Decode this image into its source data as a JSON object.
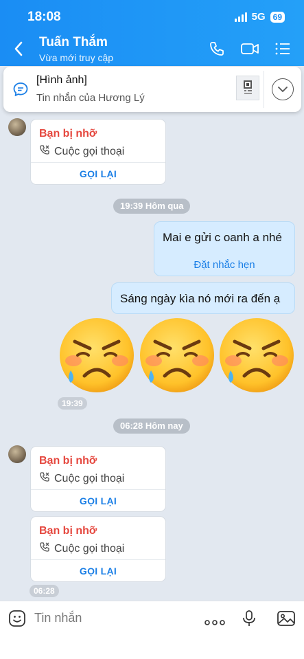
{
  "status_bar": {
    "time": "18:08",
    "network": "5G",
    "battery": "69"
  },
  "header": {
    "contact_name": "Tuấn Thắm",
    "status": "Vừa mới truy cập",
    "bg_color": "#1a8df4"
  },
  "pinned": {
    "title": "[Hình ảnh]",
    "subtitle": "Tin nhắn của Hương Lý"
  },
  "messages": {
    "call1": {
      "title": "Bạn bị nhỡ",
      "type": "Cuộc gọi thoại",
      "action": "GỌI LẠI"
    },
    "date1": "19:39 Hôm qua",
    "out1": {
      "text": "Mai e gửi c oanh a nhé",
      "action": "Đặt nhắc hẹn"
    },
    "out2": {
      "text": "Sáng ngày kìa nó mới ra đến ạ"
    },
    "emoji_time": "19:39",
    "date2": "06:28 Hôm nay",
    "call2": {
      "title": "Bạn bị nhỡ",
      "type": "Cuộc gọi thoại",
      "action": "GỌI LẠI"
    },
    "call3": {
      "title": "Bạn bị nhỡ",
      "type": "Cuộc gọi thoại",
      "action": "GỌI LẠI"
    },
    "call_time": "06:28"
  },
  "composer": {
    "placeholder": "Tin nhắn"
  },
  "colors": {
    "missed": "#e5483f",
    "link": "#1b7fe6",
    "outgoing": "#d6ecff"
  },
  "icons": [
    "back-icon",
    "phone-icon",
    "video-icon",
    "list-icon",
    "chat-bubble-icon",
    "chevron-down-icon",
    "missed-call-icon",
    "sticker-icon",
    "more-icon",
    "voice-icon",
    "image-icon"
  ]
}
